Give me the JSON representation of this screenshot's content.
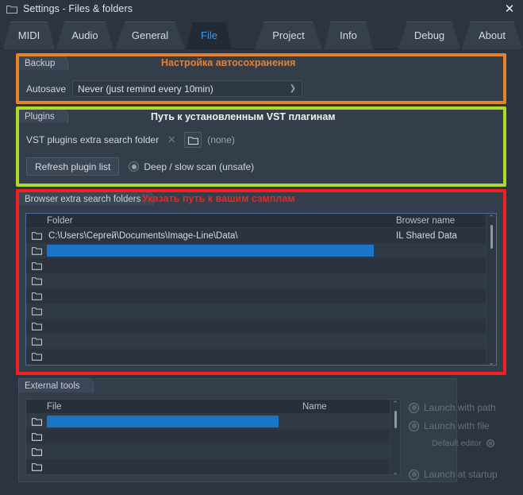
{
  "window": {
    "title": "Settings - Files & folders",
    "folder_icon": "folder-icon",
    "close_label": "✕"
  },
  "tabs": [
    {
      "label": "MIDI",
      "active": false
    },
    {
      "label": "Audio",
      "active": false
    },
    {
      "label": "General",
      "active": false
    },
    {
      "label": "File",
      "active": true
    },
    {
      "label": "Project",
      "active": false
    },
    {
      "label": "Info",
      "active": false
    },
    {
      "label": "Debug",
      "active": false
    },
    {
      "label": "About",
      "active": false
    }
  ],
  "backup": {
    "group_label": "Backup",
    "autosave_label": "Autosave",
    "autosave_value": "Never (just remind every 10min)",
    "dropdown_arrow": "❯"
  },
  "plugins": {
    "group_label": "Plugins",
    "vst_folder_label": "VST plugins extra search folder",
    "clear_icon_label": "✕",
    "browse_icon": "folder-icon",
    "vst_folder_value": "(none)",
    "refresh_button": "Refresh plugin list",
    "deep_scan_label": "Deep / slow scan (unsafe)"
  },
  "browser": {
    "group_label": "Browser extra search folders",
    "columns": [
      "Folder",
      "Browser name"
    ],
    "rows": [
      {
        "folder": "C:\\Users\\Сергей\\Documents\\Image-Line\\Data\\",
        "name": "IL Shared Data",
        "selected": false
      },
      {
        "folder": "",
        "name": "",
        "selected": true
      },
      {
        "folder": "",
        "name": "",
        "selected": false
      },
      {
        "folder": "",
        "name": "",
        "selected": false
      },
      {
        "folder": "",
        "name": "",
        "selected": false
      },
      {
        "folder": "",
        "name": "",
        "selected": false
      },
      {
        "folder": "",
        "name": "",
        "selected": false
      },
      {
        "folder": "",
        "name": "",
        "selected": false
      },
      {
        "folder": "",
        "name": "",
        "selected": false
      }
    ],
    "scroll_up": "⌃",
    "scroll_down": "⌄"
  },
  "external_tools": {
    "group_label": "External tools",
    "columns": [
      "File",
      "Name"
    ],
    "rows": [
      {
        "file": "",
        "name": "",
        "selected": true
      },
      {
        "file": "",
        "name": "",
        "selected": false
      },
      {
        "file": "",
        "name": "",
        "selected": false
      },
      {
        "file": "",
        "name": "",
        "selected": false
      }
    ],
    "scroll_up": "⌃",
    "scroll_down": "⌄",
    "options": [
      {
        "label": "Launch with path"
      },
      {
        "label": "Launch with file"
      },
      {
        "label": "Launch at startup"
      }
    ],
    "default_editor_label": "Default editor"
  },
  "annotations": [
    {
      "text": "Настройка автосохранения",
      "color": "#e0823a"
    },
    {
      "text": "Путь к установленным VST плагинам",
      "color": "#eef2ef"
    },
    {
      "text": "Указать путь к вашим сэмплам",
      "color": "#e02a2a"
    }
  ],
  "annotation_colors": {
    "backup_box": "#e8822a",
    "plugins_box": "#aedb2a",
    "browser_box": "#f42020"
  }
}
